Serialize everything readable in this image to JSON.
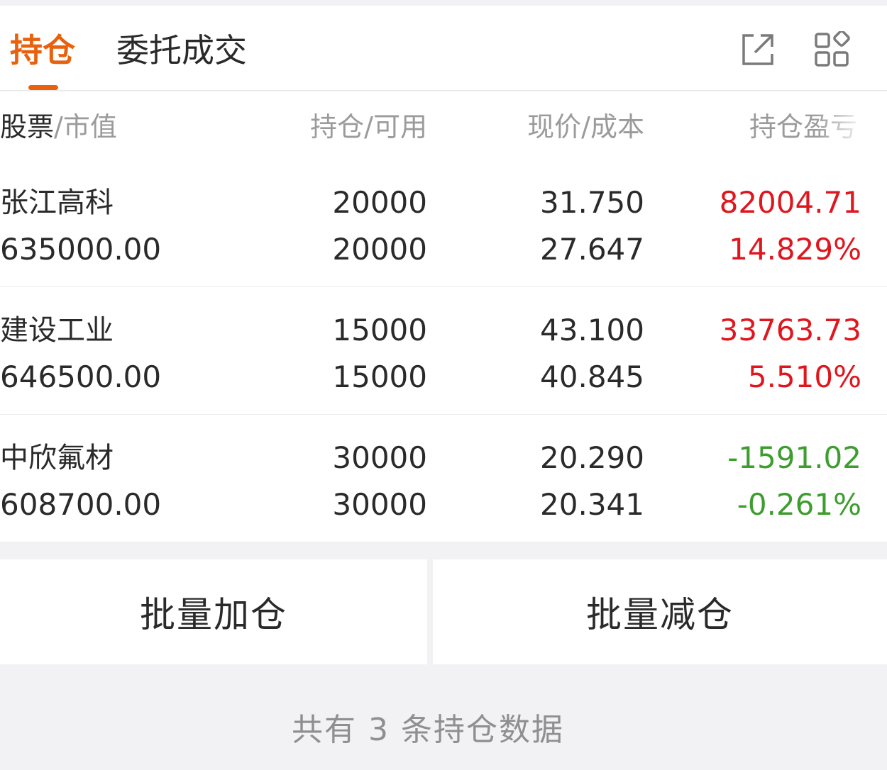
{
  "tabs": {
    "holdings": "持仓",
    "orders": "委托成交"
  },
  "colors": {
    "accent": "#e8620e",
    "up": "#e0161e",
    "down": "#3d9d2e"
  },
  "icons": {
    "export": "export-icon",
    "grid": "grid-icon"
  },
  "table": {
    "header": {
      "stock": "股票",
      "market_value": "市值",
      "position": "持仓",
      "available": "可用",
      "current_price": "现价",
      "cost": "成本",
      "pnl": "持仓盈亏",
      "sep": "/"
    },
    "rows": [
      {
        "name": "张江高科",
        "market_value": "635000.00",
        "position": "20000",
        "available": "20000",
        "price": "31.750",
        "cost": "27.647",
        "pnl": "82004.71",
        "pnl_pct": "14.829%",
        "trend": "up"
      },
      {
        "name": "建设工业",
        "market_value": "646500.00",
        "position": "15000",
        "available": "15000",
        "price": "43.100",
        "cost": "40.845",
        "pnl": "33763.73",
        "pnl_pct": "5.510%",
        "trend": "up"
      },
      {
        "name": "中欣氟材",
        "market_value": "608700.00",
        "position": "30000",
        "available": "30000",
        "price": "20.290",
        "cost": "20.341",
        "pnl": "-1591.02",
        "pnl_pct": "-0.261%",
        "trend": "down"
      }
    ]
  },
  "actions": {
    "batch_add": "批量加仓",
    "batch_reduce": "批量减仓"
  },
  "footer": {
    "summary": "共有 3 条持仓数据"
  }
}
